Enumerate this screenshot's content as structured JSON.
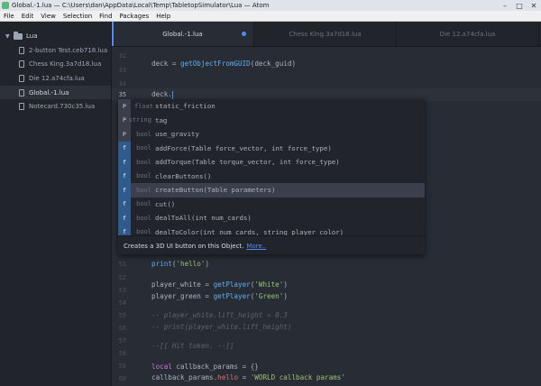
{
  "window": {
    "title": "Global.-1.lua — C:\\Users\\dan\\AppData\\Local\\Temp\\TabletopSimulator\\Lua — Atom"
  },
  "menu": [
    "File",
    "Edit",
    "View",
    "Selection",
    "Find",
    "Packages",
    "Help"
  ],
  "sidebar": {
    "root": "Lua",
    "files": [
      "2-button Test.ceb718.lua",
      "Chess King.3a7d18.lua",
      "Die 12.a74cfa.lua",
      "Global.-1.lua",
      "Notecard.730c35.lua"
    ],
    "active_index": 3
  },
  "tabs": [
    {
      "label": "Global.-1.lua",
      "active": true,
      "modified": true
    },
    {
      "label": "Chess King.3a7d18.lua",
      "active": false
    },
    {
      "label": "Die 12.a74cfa.lua",
      "active": false
    }
  ],
  "editor": {
    "line_numbers": [
      "32",
      "33",
      "34",
      "35",
      "",
      "",
      "",
      "",
      "",
      "",
      "",
      "",
      "",
      "",
      "51",
      "52",
      "53",
      "54",
      "55",
      "56",
      "57",
      "58",
      "59",
      "60",
      "61",
      "62",
      "63"
    ],
    "current_line": "35",
    "code": {
      "l33_var": "deck = ",
      "l33_fn": "getObjectFromGUID",
      "l33_rest": "(deck_guid)",
      "l35": "deck.",
      "l51": "print('hello')",
      "l51_fn": "print",
      "l51_open": "(",
      "l51_str": "'hello'",
      "l51_close": ")",
      "l53_var": "player_white = ",
      "l53_fn": "getPlayer",
      "l53_str": "'White'",
      "l54_var": "player_green = ",
      "l54_fn": "getPlayer",
      "l54_str": "'Green'",
      "l56": "-- player_white.lift_height = 0.3",
      "l57": "-- print(player_white.lift_height)",
      "l59": "--[[ Hit token. --]]",
      "l61_kw": "local",
      "l61_rest": " callback_params = {}",
      "l62_a": "callback_params.",
      "l62_prop": "hello",
      "l62_b": " = ",
      "l62_str": "'WORLD callback params'"
    }
  },
  "autocomplete": {
    "items": [
      {
        "badge": "P",
        "kind": "property",
        "type": "float",
        "text": "static_friction"
      },
      {
        "badge": "P",
        "kind": "property",
        "type": "string",
        "text": "tag"
      },
      {
        "badge": "P",
        "kind": "property",
        "type": "bool",
        "text": "use_gravity"
      },
      {
        "badge": "f",
        "kind": "function",
        "type": "bool",
        "text": "addForce(Table force_vector, int force_type)"
      },
      {
        "badge": "f",
        "kind": "function",
        "type": "bool",
        "text": "addTorque(Table torque_vector, int force_type)"
      },
      {
        "badge": "f",
        "kind": "function",
        "type": "bool",
        "text": "clearButtons()"
      },
      {
        "badge": "f",
        "kind": "function",
        "type": "bool",
        "text": "createButton(Table parameters)"
      },
      {
        "badge": "f",
        "kind": "function",
        "type": "bool",
        "text": "cut()"
      },
      {
        "badge": "f",
        "kind": "function",
        "type": "bool",
        "text": "dealToAll(int num_cards)"
      },
      {
        "badge": "f",
        "kind": "function",
        "type": "bool",
        "text": "dealToColor(int num_cards, string player_color)"
      }
    ],
    "selected_index": 6,
    "description": "Creates a 3D UI button on this Object.",
    "more_link": "More.."
  },
  "colors": {
    "accent": "#568af2",
    "function": "#61afef",
    "string": "#98c379",
    "keyword": "#c678dd",
    "comment": "#5c6370"
  }
}
